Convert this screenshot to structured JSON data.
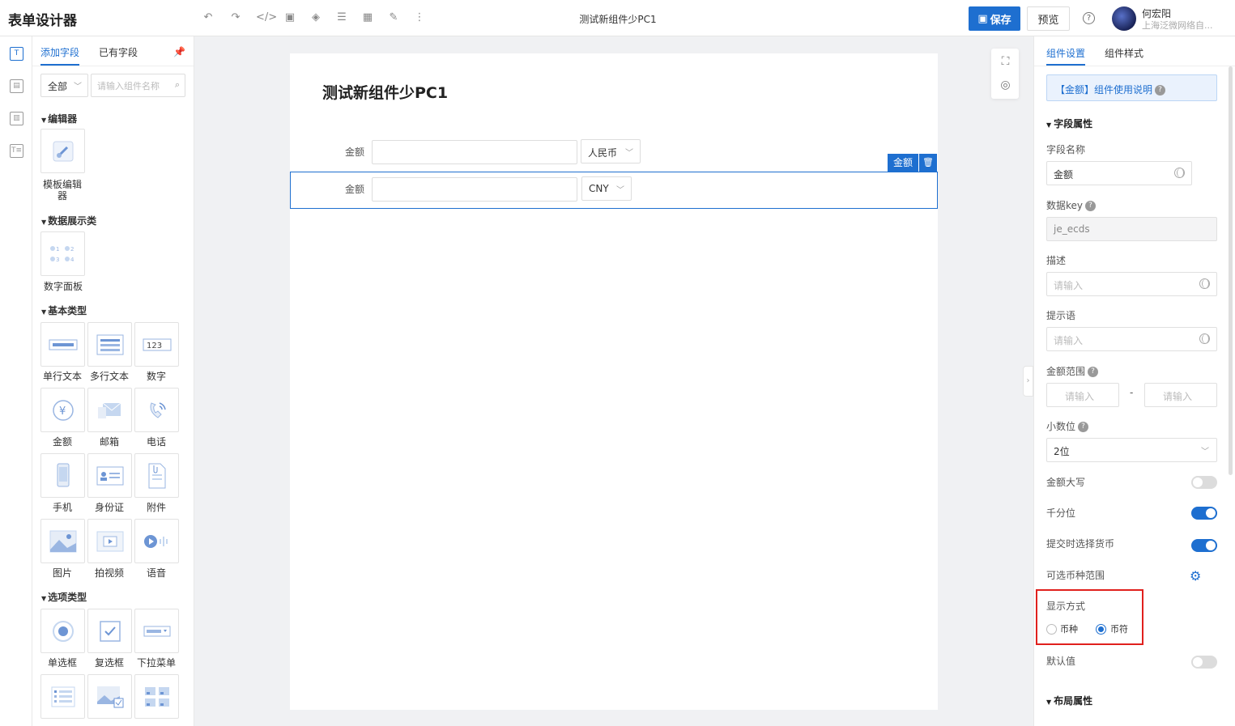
{
  "header": {
    "app_title": "表单设计器",
    "form_name": "测试新组件少PC1",
    "save_label": "保存",
    "preview_label": "预览",
    "help_icon": "?",
    "user_name": "何宏阳",
    "user_org": "上海泛微网络自..."
  },
  "left_panel": {
    "tabs": [
      "添加字段",
      "已有字段"
    ],
    "filter_value": "全部",
    "search_placeholder": "请输入组件名称",
    "categories": {
      "editor": "编辑器",
      "display": "数据展示类",
      "basic": "基本类型",
      "option": "选项类型"
    },
    "components": {
      "template_editor": "模板编辑器",
      "number_panel": "数字面板",
      "single_text": "单行文本",
      "multi_text": "多行文本",
      "number": "数字",
      "amount": "金额",
      "email": "邮箱",
      "phone": "电话",
      "mobile": "手机",
      "id_card": "身份证",
      "attachment": "附件",
      "image": "图片",
      "video": "拍视频",
      "voice": "语音",
      "radio": "单选框",
      "checkbox": "复选框",
      "dropdown": "下拉菜单"
    }
  },
  "canvas": {
    "title": "测试新组件少PC1",
    "rows": [
      {
        "label": "金额",
        "currency": "人民币"
      },
      {
        "label": "金额",
        "currency": "CNY"
      }
    ],
    "selected_tag": "金额"
  },
  "right_panel": {
    "tabs": [
      "组件设置",
      "组件样式"
    ],
    "notice": "【金额】组件使用说明",
    "field_section": "字段属性",
    "field_name_label": "字段名称",
    "field_name_value": "金额",
    "data_key_label": "数据key",
    "data_key_value": "je_ecds",
    "desc_label": "描述",
    "desc_placeholder": "请输入",
    "hint_label": "提示语",
    "hint_placeholder": "请输入",
    "range_label": "金额范围",
    "range_min_placeholder": "请输入",
    "range_max_placeholder": "请输入",
    "range_sep": "-",
    "decimal_label": "小数位",
    "decimal_value": "2位",
    "uppercase_label": "金额大写",
    "uppercase_on": false,
    "thousands_label": "千分位",
    "thousands_on": true,
    "choose_currency_label": "提交时选择货币",
    "choose_currency_on": true,
    "currency_range_label": "可选币种范围",
    "display_mode_label": "显示方式",
    "display_options": [
      "币种",
      "币符"
    ],
    "display_selected": "币符",
    "default_label": "默认值",
    "default_on": false,
    "layout_section": "布局属性"
  },
  "colors": {
    "accent": "#1e6fd0",
    "highlight": "#e0201d"
  }
}
